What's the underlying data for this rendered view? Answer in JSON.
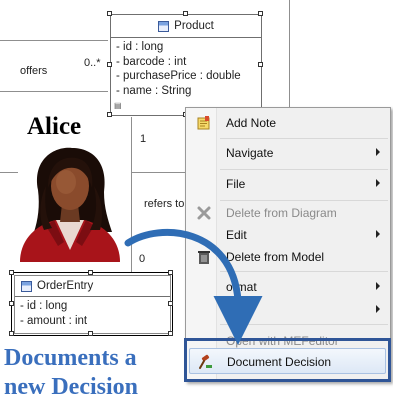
{
  "diagram": {
    "product": {
      "name": "Product",
      "attributes": [
        "- id : long",
        "- barcode : int",
        "- purchasePrice : double",
        "- name : String"
      ]
    },
    "order_entry": {
      "name": "OrderEntry",
      "attributes": [
        "- id : long",
        "- amount : int"
      ]
    },
    "offers_label": "offers",
    "offers_multiplicity": "0..*",
    "refers_label": "refers to",
    "one_multiplicity": "1",
    "zero_multiplicity": "0"
  },
  "actor": {
    "name": "Alice"
  },
  "menu": {
    "items": [
      {
        "label": "Add Note",
        "icon": "note-icon",
        "submenu": false,
        "disabled": false
      },
      {
        "label": "Navigate",
        "icon": "",
        "submenu": true,
        "disabled": false
      },
      {
        "label": "File",
        "icon": "",
        "submenu": true,
        "disabled": false
      },
      {
        "label": "Delete from Diagram",
        "icon": "delete-x-icon",
        "submenu": false,
        "disabled": true
      },
      {
        "label": "Edit",
        "icon": "",
        "submenu": true,
        "disabled": false
      },
      {
        "label": "Delete from Model",
        "icon": "trash-icon",
        "submenu": false,
        "disabled": false
      },
      {
        "label": "ormat",
        "icon": "",
        "submenu": true,
        "disabled": false
      },
      {
        "label": "ilters",
        "icon": "",
        "submenu": true,
        "disabled": false
      },
      {
        "label": "Open with MEFeditor",
        "icon": "",
        "submenu": false,
        "disabled": true
      },
      {
        "label": "Document Decision",
        "icon": "decision-gavel-icon",
        "submenu": false,
        "disabled": false,
        "highlighted": true
      }
    ]
  },
  "caption": {
    "line1": "Documents a",
    "line2": "new Decision"
  },
  "colors": {
    "caption": "#3a6fbd",
    "focus_box": "#2f5597",
    "arrow": "#2f6db5",
    "menu_bg": "#f0f0f0"
  }
}
